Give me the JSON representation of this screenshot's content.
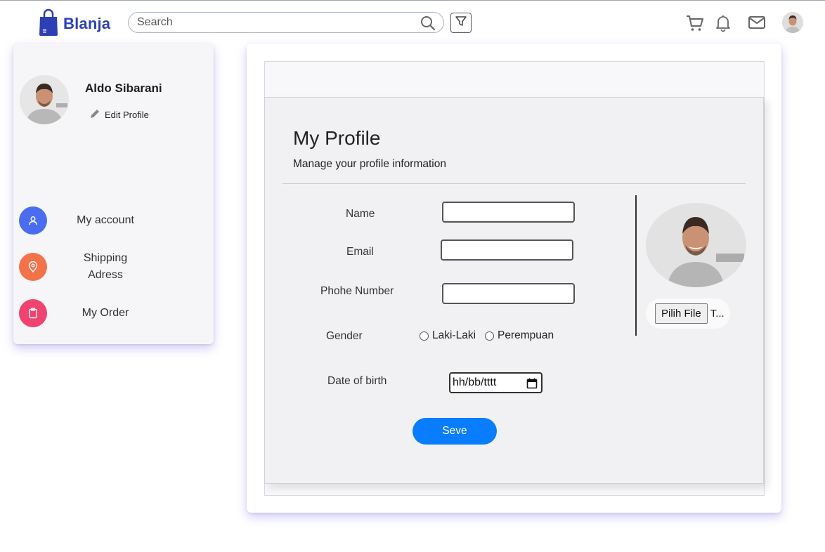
{
  "header": {
    "brand": "Blanja",
    "brand_color": "#2d3fb5",
    "search_placeholder": "Search",
    "icons": [
      "search-icon",
      "filter-icon",
      "cart-icon",
      "bell-icon",
      "mail-icon",
      "avatar"
    ]
  },
  "sidebar": {
    "user_name": "Aldo Sibarani",
    "edit_profile": "Edit Profile",
    "items": [
      {
        "label": "My account",
        "icon": "user-icon",
        "color": "#4a6cf0"
      },
      {
        "label": "Shipping Adress",
        "icon": "location-pin-icon",
        "color": "#f3724a"
      },
      {
        "label": "My Order",
        "icon": "clipboard-icon",
        "color": "#f1436f"
      }
    ]
  },
  "profile": {
    "title": "My Profile",
    "subtitle": "Manage your profile information",
    "fields": {
      "name_label": "Name",
      "email_label": "Email",
      "phone_label": "Phohe Number",
      "gender_label": "Gender",
      "gender_options": [
        "Laki-Laki",
        "Perempuan"
      ],
      "dob_label": "Date of birth",
      "dob_placeholder": "hh/bb/tttt"
    },
    "save_label": "Seve",
    "save_color": "#0a7cff",
    "file_button": "Pilih File",
    "file_status": "T..."
  }
}
